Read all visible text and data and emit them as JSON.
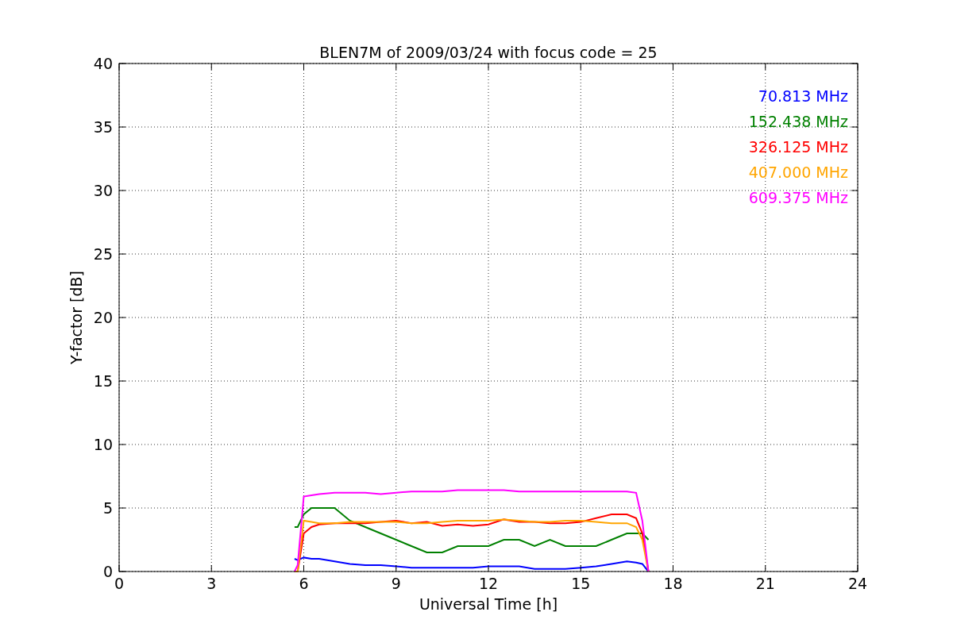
{
  "chart_data": {
    "type": "line",
    "title": "BLEN7M of 2009/03/24 with focus code = 25",
    "xlabel": "Universal Time [h]",
    "ylabel": "Y-factor [dB]",
    "xlim": [
      0,
      24
    ],
    "ylim": [
      0,
      40
    ],
    "grid": true,
    "xticks": [
      0,
      3,
      6,
      9,
      12,
      15,
      18,
      21,
      24
    ],
    "yticks": [
      0,
      5,
      10,
      15,
      20,
      25,
      30,
      35,
      40
    ],
    "x": [
      5.7,
      5.8,
      6.0,
      6.25,
      6.5,
      7,
      7.5,
      8,
      8.5,
      9,
      9.5,
      10,
      10.5,
      11,
      11.5,
      12,
      12.5,
      13,
      13.5,
      14,
      14.5,
      15,
      15.5,
      16,
      16.5,
      16.8,
      17,
      17.2
    ],
    "series": [
      {
        "name": "70.813 MHz",
        "color": "#0000ff",
        "values": [
          1.0,
          0.9,
          1.1,
          1.0,
          1.0,
          0.8,
          0.6,
          0.5,
          0.5,
          0.4,
          0.3,
          0.3,
          0.3,
          0.3,
          0.3,
          0.4,
          0.4,
          0.4,
          0.2,
          0.2,
          0.2,
          0.3,
          0.4,
          0.6,
          0.8,
          0.7,
          0.6,
          0
        ]
      },
      {
        "name": "152.438 MHz",
        "color": "#008000",
        "values": [
          3.5,
          3.5,
          4.5,
          5,
          5,
          5,
          4,
          3.5,
          3,
          2.5,
          2,
          1.5,
          1.5,
          2,
          2,
          2,
          2.5,
          2.5,
          2,
          2.5,
          2,
          2,
          2,
          2.5,
          3,
          3,
          3,
          2.5
        ]
      },
      {
        "name": "326.125 MHz",
        "color": "#ff0000",
        "values": [
          0,
          0,
          3,
          3.5,
          3.7,
          3.8,
          3.8,
          3.8,
          3.9,
          4,
          3.8,
          3.9,
          3.6,
          3.7,
          3.6,
          3.7,
          4.1,
          3.9,
          3.9,
          3.8,
          3.8,
          3.9,
          4.2,
          4.5,
          4.5,
          4.2,
          3,
          0
        ]
      },
      {
        "name": "407.000 MHz",
        "color": "#ffa500",
        "values": [
          0,
          0,
          4,
          3.9,
          3.8,
          3.8,
          3.9,
          3.9,
          3.9,
          3.9,
          3.8,
          3.8,
          3.9,
          4,
          4,
          4,
          4.1,
          4,
          3.9,
          3.9,
          4,
          4,
          3.9,
          3.8,
          3.8,
          3.5,
          2.5,
          0
        ]
      },
      {
        "name": "609.375 MHz",
        "color": "#ff00ff",
        "values": [
          0,
          0.5,
          5.9,
          6.0,
          6.1,
          6.2,
          6.2,
          6.2,
          6.1,
          6.2,
          6.3,
          6.3,
          6.3,
          6.4,
          6.4,
          6.4,
          6.4,
          6.3,
          6.3,
          6.3,
          6.3,
          6.3,
          6.3,
          6.3,
          6.3,
          6.2,
          4,
          0
        ]
      }
    ]
  }
}
